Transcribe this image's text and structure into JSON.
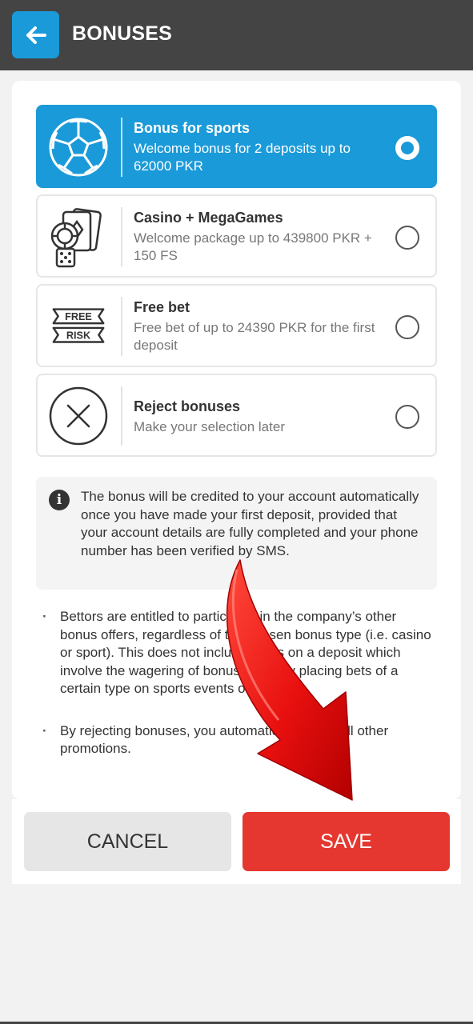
{
  "header": {
    "title": "BONUSES"
  },
  "options": [
    {
      "title": "Bonus for sports",
      "desc": "Welcome bonus for 2 deposits up to 62000 PKR",
      "icon": "soccer-ball-icon",
      "selected": true
    },
    {
      "title": "Casino + MegaGames",
      "desc": "Welcome package up to 439800 PKR + 150 FS",
      "icon": "casino-cards-icon",
      "selected": false
    },
    {
      "title": "Free bet",
      "desc": "Free bet of up to 24390 PKR for the first deposit",
      "icon": "free-risk-icon",
      "selected": false,
      "icon_labels": [
        "FREE",
        "RISK"
      ]
    },
    {
      "title": "Reject bonuses",
      "desc": "Make your selection later",
      "icon": "reject-x-icon",
      "selected": false
    }
  ],
  "info": {
    "icon": "info-icon",
    "text": "The bonus will be credited to your account automatically once you have made your first deposit, provided that your account details are fully completed and your phone number has been verified by SMS."
  },
  "notes": [
    "Bettors are entitled to participate in the company’s other bonus offers, regardless of the chosen bonus type (i.e. casino or sport). This does not include offers on a deposit which involve the wagering of bonus funds by placing bets of a certain type on sports events or slots.",
    "By rejecting bonuses, you automatically reject all other promotions."
  ],
  "buttons": {
    "cancel": "CANCEL",
    "save": "SAVE"
  },
  "colors": {
    "header": "#444444",
    "accent": "#1b9ad9",
    "save": "#e53730",
    "overlay_arrow": "#e8100f"
  }
}
